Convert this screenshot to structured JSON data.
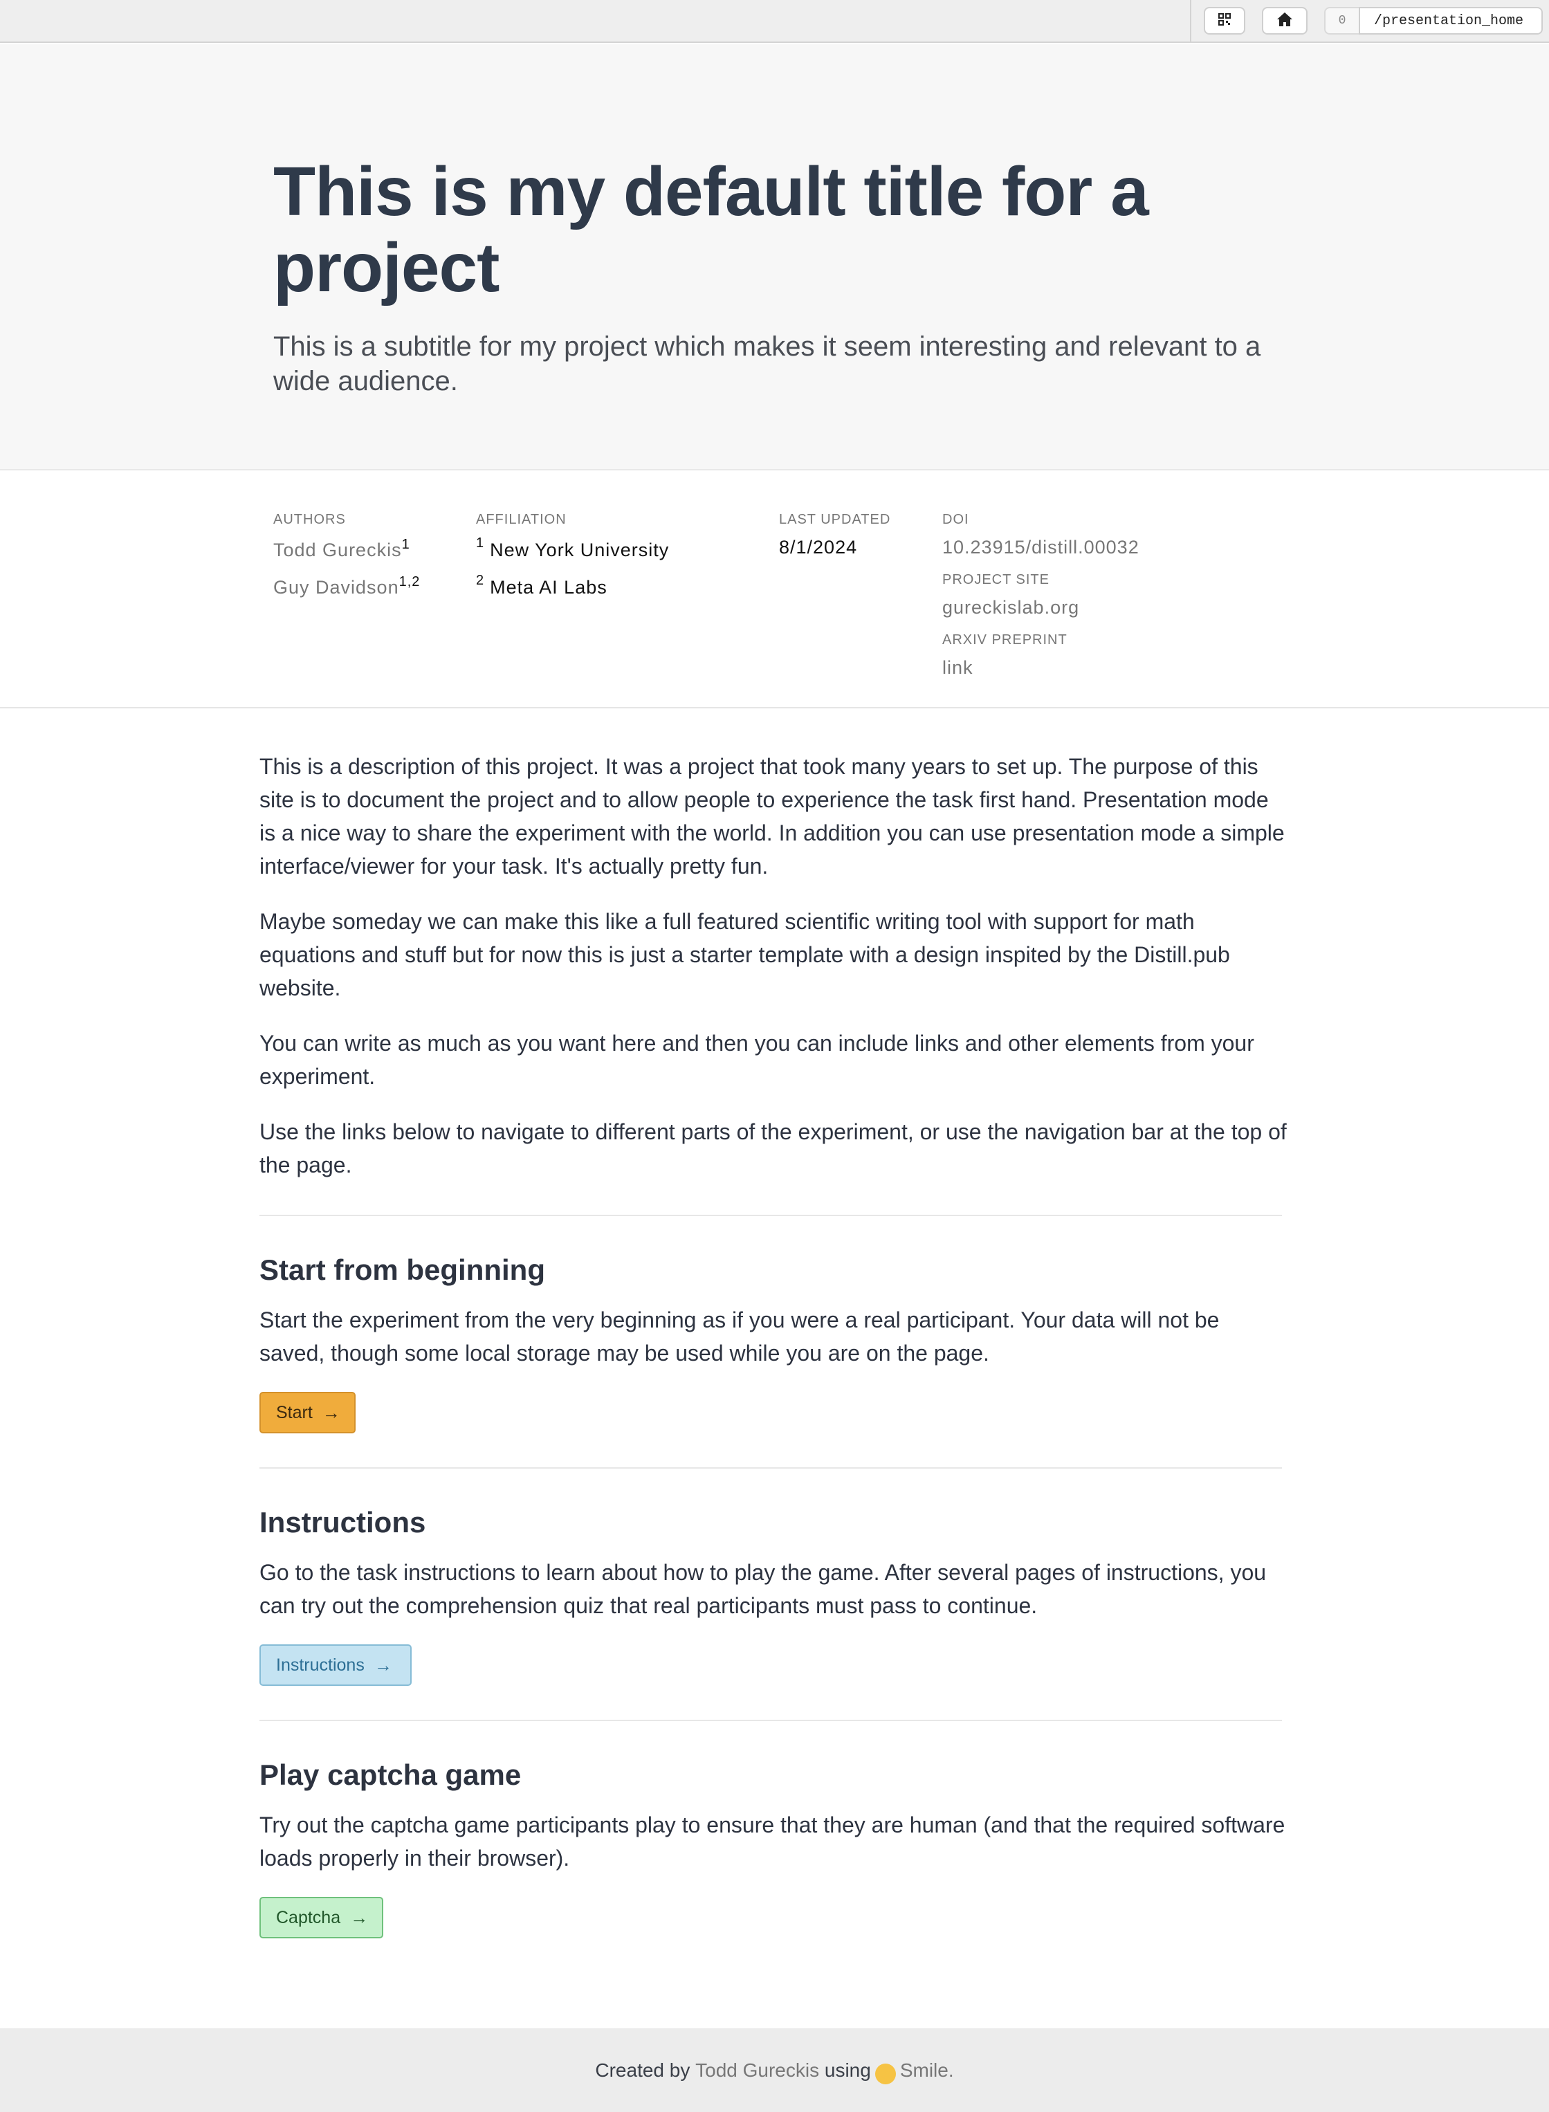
{
  "topbar": {
    "count": "0",
    "path": "/presentation_home",
    "grid_icon": "grid-icon",
    "home_icon": "home-icon"
  },
  "hero": {
    "title": "This is my default title for a project",
    "subtitle": "This is a subtitle for my project which makes it seem interesting and relevant to a wide audience."
  },
  "meta": {
    "authors_label": "AUTHORS",
    "authors": [
      {
        "name": "Todd Gureckis",
        "sup": "1"
      },
      {
        "name": "Guy Davidson",
        "sup": "1,2"
      }
    ],
    "affiliation_label": "AFFILIATION",
    "affiliations": [
      {
        "num": "1",
        "name": "New York University"
      },
      {
        "num": "2",
        "name": "Meta AI Labs"
      }
    ],
    "updated_label": "LAST UPDATED",
    "updated": "8/1/2024",
    "doi_label": "DOI",
    "doi": "10.23915/distill.00032",
    "site_label": "PROJECT SITE",
    "site": "gureckislab.org",
    "arxiv_label": "ARXIV PREPRINT",
    "arxiv": "link"
  },
  "description": [
    "This is a description of this project. It was a project that took many years to set up. The purpose of this site is to document the project and to allow people to experience the task first hand. Presentation mode is a nice way to share the experiment with the world. In addition you can use presentation mode a simple interface/viewer for your task. It's actually pretty fun.",
    "Maybe someday we can make this like a full featured scientific writing tool with support for math equations and stuff but for now this is just a starter template with a design inspited by the Distill.pub website.",
    "You can write as much as you want here and then you can include links and other elements from your experiment.",
    "Use the links below to navigate to different parts of the experiment, or use the navigation bar at the top of the page."
  ],
  "sections": {
    "start": {
      "heading": "Start from beginning",
      "text": "Start the experiment from the very beginning as if you were a real participant. Your data will not be saved, though some local storage may be used while you are on the page.",
      "button": "Start",
      "color": "#f0ac3c"
    },
    "instructions": {
      "heading": "Instructions",
      "text": "Go to the task instructions to learn about how to play the game. After several pages of instructions, you can try out the comprehension quiz that real participants must pass to continue.",
      "button": "Instructions",
      "color": "#c4e3f2"
    },
    "captcha": {
      "heading": "Play captcha game",
      "text": "Try out the captcha game participants play to ensure that they are human (and that the required software loads properly in their browser).",
      "button": "Captcha",
      "color": "#c5f1cc"
    }
  },
  "footer": {
    "prefix": "Created by",
    "author": "Todd Gureckis",
    "using": "using",
    "tool": "Smile."
  }
}
